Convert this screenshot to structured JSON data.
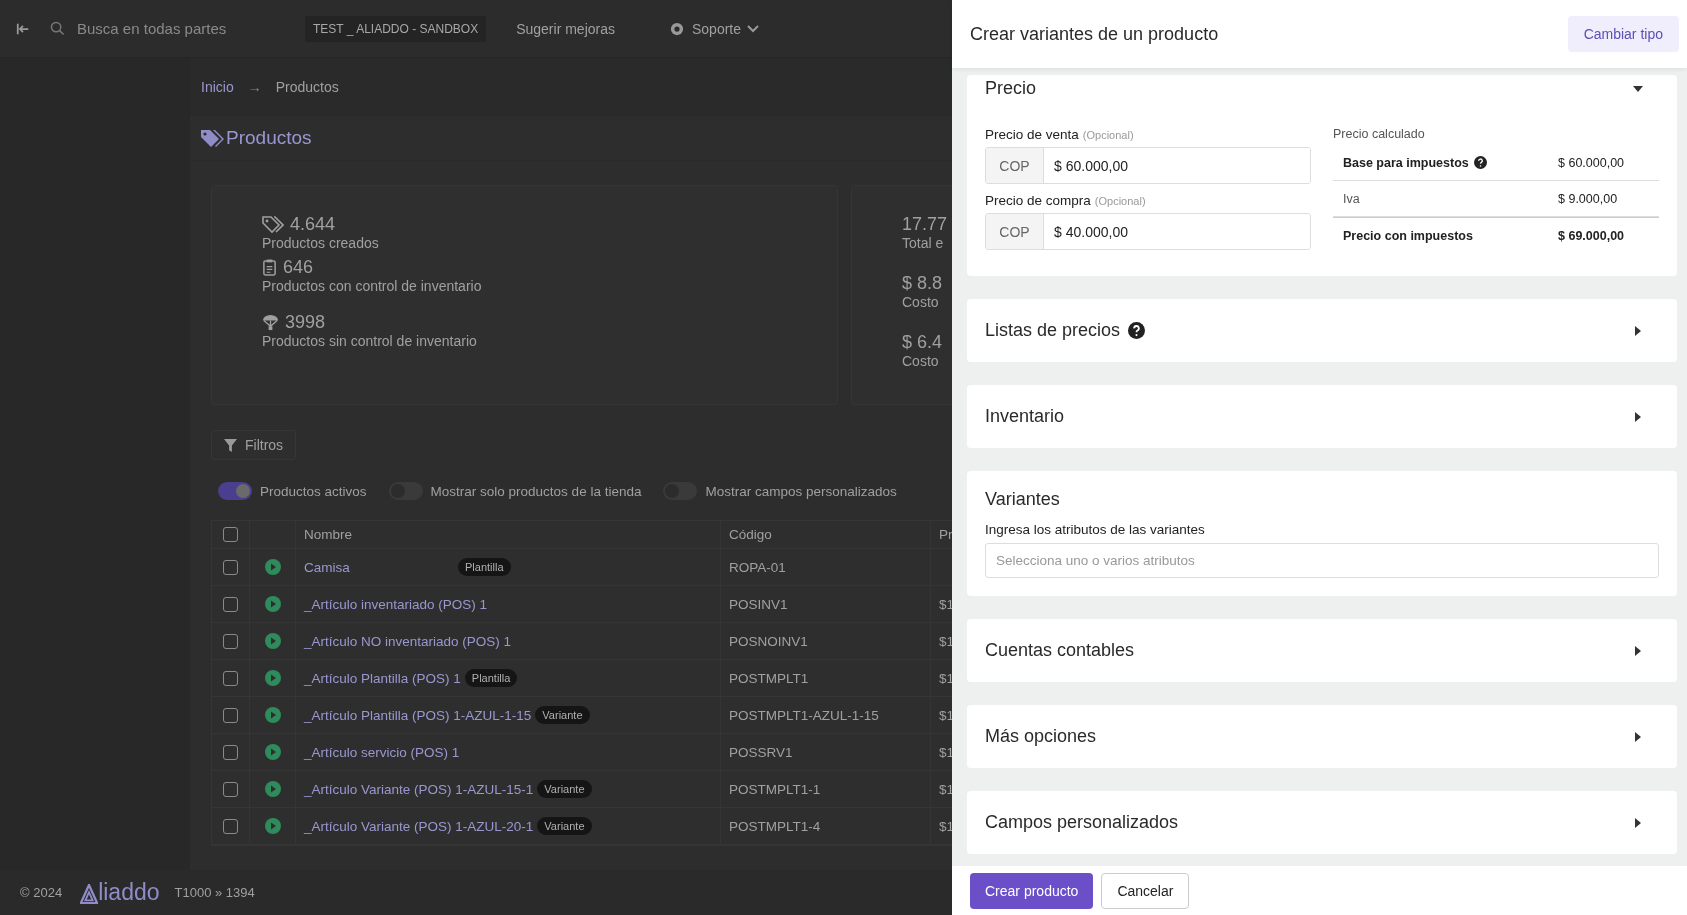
{
  "topbar": {
    "search": {
      "placeholder": "Busca en todas partes"
    },
    "environment": "TEST _ ALIADDO - SANDBOX",
    "link": "Sugerir mejoras",
    "support": "Soporte"
  },
  "breadcrumb": {
    "items": [
      "Inicio",
      "Productos"
    ],
    "separator": "→"
  },
  "page_title": "Productos",
  "stats": [
    {
      "kind": "tags",
      "value": "4.644",
      "label": "Productos creados"
    },
    {
      "kind": "clipboard",
      "value": "646",
      "label": "Productos con control de inventario"
    },
    {
      "kind": "parachute",
      "value": "3998",
      "label": "Productos sin control de inventario"
    }
  ],
  "stats_side": [
    {
      "value": "17.77",
      "label": "Total e"
    },
    {
      "value": "$ 8.8",
      "label": "Costo"
    },
    {
      "value": "$ 6.4",
      "label": "Costo"
    }
  ],
  "filters_button": "Filtros",
  "toggles": [
    {
      "label": "Productos activos",
      "on": true
    },
    {
      "label": "Mostrar solo productos de la tienda",
      "on": false
    },
    {
      "label": "Mostrar campos personalizados",
      "on": false
    }
  ],
  "table": {
    "select_all_checked": false,
    "columns": [
      "Nombre",
      "Código",
      "Pr"
    ],
    "rows": [
      {
        "checked": false,
        "name": "Camisa",
        "tag": "Plantilla",
        "code": "ROPA-01"
      },
      {
        "checked": false,
        "name": "_Artículo inventariado (POS) 1",
        "code": "POSINV1",
        "price": "$1"
      },
      {
        "checked": false,
        "name": "_Artículo NO inventariado (POS) 1",
        "code": "POSNOINV1",
        "price": "$1"
      },
      {
        "checked": false,
        "name": "_Artículo Plantilla (POS) 1",
        "tag": "Plantilla",
        "code": "POSTMPLT1",
        "price": "$1"
      },
      {
        "checked": false,
        "name": "_Artículo Plantilla (POS) 1-AZUL-1-15",
        "tag": "Variante",
        "code": "POSTMPLT1-AZUL-1-15",
        "price": "$1"
      },
      {
        "checked": false,
        "name": "_Artículo servicio (POS) 1",
        "code": "POSSRV1",
        "price": "$1"
      },
      {
        "checked": false,
        "name": "_Artículo Variante (POS) 1-AZUL-15-1",
        "tag": "Variante",
        "code": "POSTMPLT1-1",
        "price": "$1"
      },
      {
        "checked": false,
        "name": "_Artículo Variante (POS) 1-AZUL-20-1",
        "tag": "Variante",
        "code": "POSTMPLT1-4",
        "price": "$1"
      }
    ]
  },
  "footer": {
    "copyright": "© 2024",
    "brand": "liaddo",
    "version": "T1000 » 1394"
  },
  "drawer": {
    "title": "Crear variantes de un producto",
    "header_button": "Cambiar tipo",
    "price": {
      "title": "Precio",
      "expanded": true,
      "fields": [
        {
          "label": "Precio de venta",
          "hint": "(Opcional)",
          "prefix": "COP",
          "value": "$ 60.000,00"
        },
        {
          "label": "Precio de compra",
          "hint": "(Opcional)",
          "prefix": "COP",
          "value": "$ 40.000,00"
        }
      ],
      "calc_title": "Precio calculado",
      "calc_rows": [
        {
          "kind": "base",
          "label": "Base para impuestos",
          "help": true,
          "value": "$ 60.000,00"
        },
        {
          "kind": "tax",
          "label": "Iva",
          "help": false,
          "value": "$ 9.000,00"
        },
        {
          "kind": "total",
          "label": "Precio con impuestos",
          "help": false,
          "value": "$ 69.000,00"
        }
      ]
    },
    "sections": [
      {
        "kind": "panel",
        "title": "Listas de precios",
        "help": true,
        "expanded": false
      },
      {
        "kind": "panel",
        "title": "Inventario",
        "help": false,
        "expanded": false
      },
      {
        "kind": "attributes",
        "title": "Variantes",
        "field_label": "Ingresa los atributos de las variantes",
        "placeholder": "Selecciona uno o varios atributos"
      },
      {
        "kind": "panel",
        "title": "Cuentas contables",
        "help": false,
        "expanded": false
      },
      {
        "kind": "panel",
        "title": "Más opciones",
        "help": false,
        "expanded": false
      },
      {
        "kind": "panel",
        "title": "Campos personalizados",
        "help": false,
        "expanded": false
      }
    ],
    "buttons": [
      {
        "kind": "primary",
        "label": "Crear producto"
      },
      {
        "kind": "secondary",
        "label": "Cancelar"
      }
    ]
  }
}
